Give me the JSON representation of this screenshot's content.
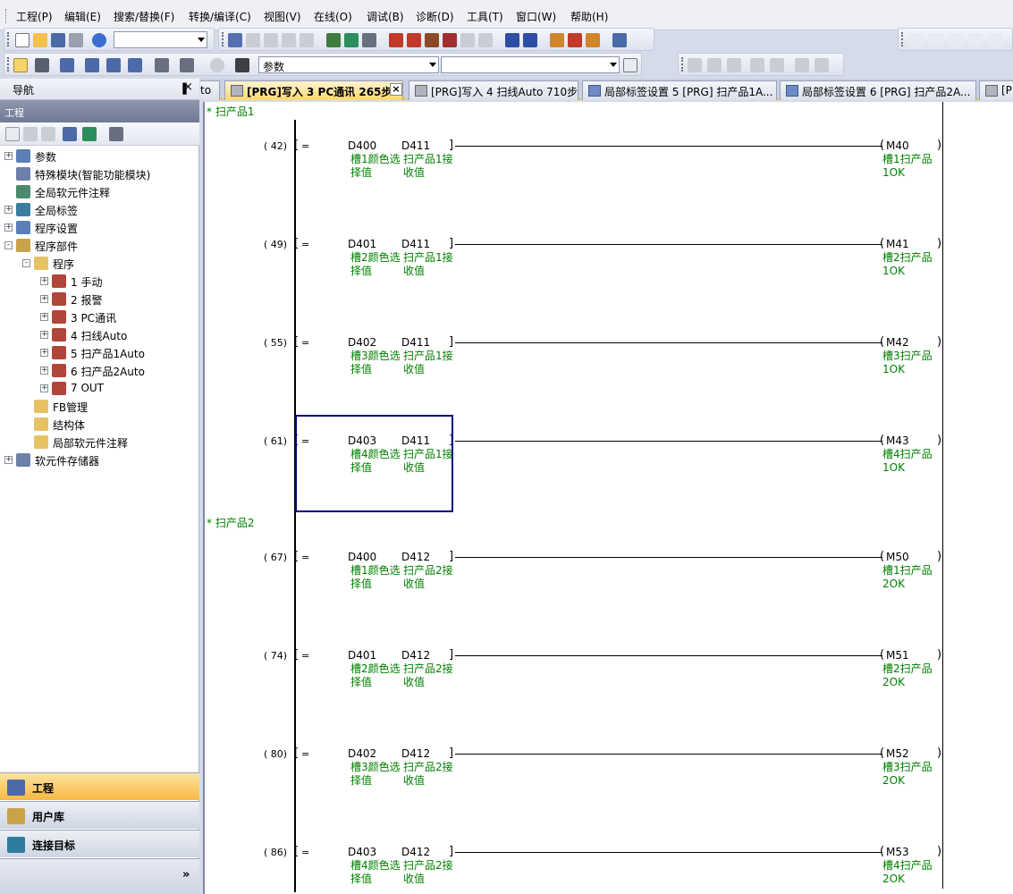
{
  "menu": [
    "工程(P)",
    "编辑(E)",
    "搜索/替换(F)",
    "转换/编译(C)",
    "视图(V)",
    "在线(O)",
    "调试(B)",
    "诊断(D)",
    "工具(T)",
    "窗口(W)",
    "帮助(H)"
  ],
  "toolbar": {
    "combo_search": "参数",
    "combo2": "",
    "combo3": ""
  },
  "nav": {
    "title": "导航",
    "pin": "ᅟ",
    "close": "×",
    "project_section": "工程",
    "tree": [
      {
        "label": "参数",
        "exp": "+",
        "lvl": 0
      },
      {
        "label": "特殊模块(智能功能模块)",
        "exp": "",
        "lvl": 0
      },
      {
        "label": "全局软元件注释",
        "exp": "",
        "lvl": 0
      },
      {
        "label": "全局标签",
        "exp": "+",
        "lvl": 0
      },
      {
        "label": "程序设置",
        "exp": "+",
        "lvl": 0
      },
      {
        "label": "程序部件",
        "exp": "-",
        "lvl": 0
      },
      {
        "label": "程序",
        "exp": "-",
        "lvl": 1
      },
      {
        "label": "1 手动",
        "exp": "+",
        "lvl": 2
      },
      {
        "label": "2 报警",
        "exp": "+",
        "lvl": 2
      },
      {
        "label": "3 PC通讯",
        "exp": "+",
        "lvl": 2
      },
      {
        "label": "4 扫线Auto",
        "exp": "+",
        "lvl": 2
      },
      {
        "label": "5 扫产品1Auto",
        "exp": "+",
        "lvl": 2
      },
      {
        "label": "6 扫产品2Auto",
        "exp": "+",
        "lvl": 2
      },
      {
        "label": "7 OUT",
        "exp": "+",
        "lvl": 2
      },
      {
        "label": "FB管理",
        "exp": "",
        "lvl": 1
      },
      {
        "label": "结构体",
        "exp": "",
        "lvl": 1
      },
      {
        "label": "局部软元件注释",
        "exp": "",
        "lvl": 1
      },
      {
        "label": "软元件存储器",
        "exp": "+",
        "lvl": 0
      }
    ],
    "bottom": [
      {
        "label": "工程"
      },
      {
        "label": "用户库"
      },
      {
        "label": "连接目标"
      }
    ],
    "more": "»"
  },
  "tabs": [
    {
      "label": "to"
    },
    {
      "label": "[PRG]写入 3 PC通讯 265步"
    },
    {
      "label": "[PRG]写入 4 扫线Auto 710步"
    },
    {
      "label": "局部标签设置 5 [PRG] 扫产品1A..."
    },
    {
      "label": "局部标签设置 6 [PRG] 扫产品2A..."
    },
    {
      "label": "[PI"
    }
  ],
  "ladder": {
    "sections": [
      {
        "title": "* 扫产品1",
        "rungs": [
          {
            "step": "( 42)",
            "op": "=",
            "s1": "D400",
            "s2": "D411",
            "c1a": "槽1颜色选",
            "c1b": "择值",
            "c2a": "扫产品1接",
            "c2b": "收值",
            "coil": "M40",
            "ca": "槽1扫产品",
            "cb": "1OK"
          },
          {
            "step": "( 49)",
            "op": "=",
            "s1": "D401",
            "s2": "D411",
            "c1a": "槽2颜色选",
            "c1b": "择值",
            "c2a": "扫产品1接",
            "c2b": "收值",
            "coil": "M41",
            "ca": "槽2扫产品",
            "cb": "1OK"
          },
          {
            "step": "( 55)",
            "op": "=",
            "s1": "D402",
            "s2": "D411",
            "c1a": "槽3颜色选",
            "c1b": "择值",
            "c2a": "扫产品1接",
            "c2b": "收值",
            "coil": "M42",
            "ca": "槽3扫产品",
            "cb": "1OK"
          },
          {
            "step": "( 61)",
            "op": "=",
            "s1": "D403",
            "s2": "D411",
            "c1a": "槽4颜色选",
            "c1b": "择值",
            "c2a": "扫产品1接",
            "c2b": "收值",
            "coil": "M43",
            "ca": "槽4扫产品",
            "cb": "1OK"
          }
        ]
      },
      {
        "title": "* 扫产品2",
        "rungs": [
          {
            "step": "( 67)",
            "op": "=",
            "s1": "D400",
            "s2": "D412",
            "c1a": "槽1颜色选",
            "c1b": "择值",
            "c2a": "扫产品2接",
            "c2b": "收值",
            "coil": "M50",
            "ca": "槽1扫产品",
            "cb": "2OK"
          },
          {
            "step": "( 74)",
            "op": "=",
            "s1": "D401",
            "s2": "D412",
            "c1a": "槽2颜色选",
            "c1b": "择值",
            "c2a": "扫产品2接",
            "c2b": "收值",
            "coil": "M51",
            "ca": "槽2扫产品",
            "cb": "2OK"
          },
          {
            "step": "( 80)",
            "op": "=",
            "s1": "D402",
            "s2": "D412",
            "c1a": "槽3颜色选",
            "c1b": "择值",
            "c2a": "扫产品2接",
            "c2b": "收值",
            "coil": "M52",
            "ca": "槽3扫产品",
            "cb": "2OK"
          },
          {
            "step": "( 86)",
            "op": "=",
            "s1": "D403",
            "s2": "D412",
            "c1a": "槽4颜色选",
            "c1b": "择值",
            "c2a": "扫产品2接",
            "c2b": "收值",
            "coil": "M53",
            "ca": "槽4扫产品",
            "cb": "2OK"
          }
        ]
      }
    ]
  },
  "colors": {
    "accent": "#fbd971",
    "comment": "#008000",
    "selection": "#000080"
  }
}
